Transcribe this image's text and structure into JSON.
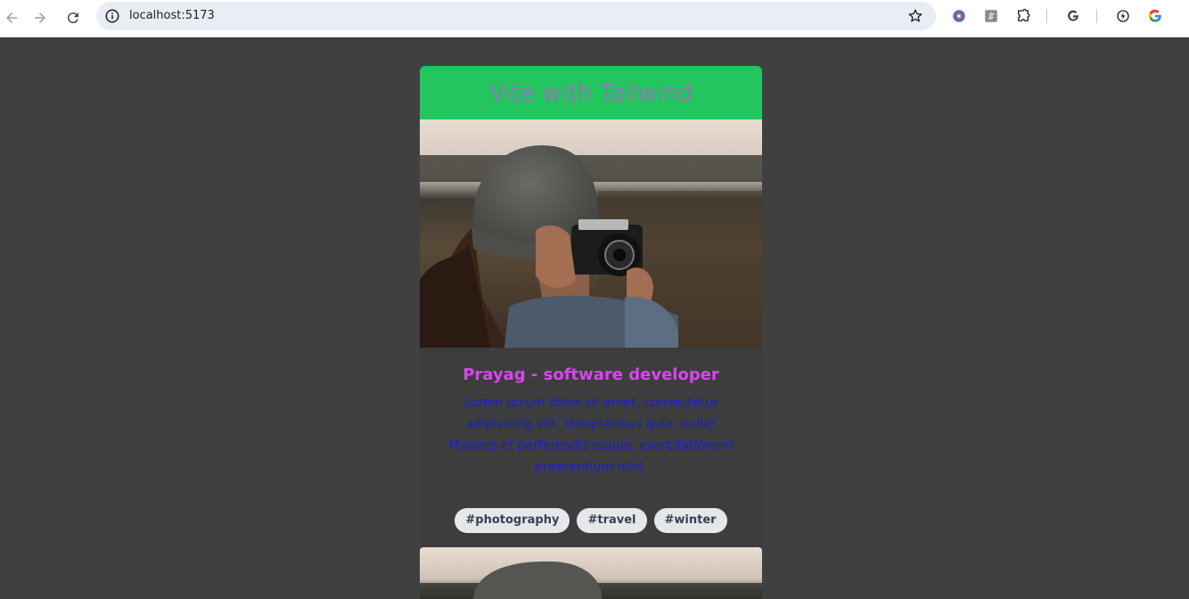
{
  "browser": {
    "url": "localhost:5173",
    "icons": [
      "back-arrow-icon",
      "forward-arrow-icon",
      "reload-icon",
      "site-info-icon",
      "bookmark-star-icon",
      "extensions-puzzle-icon",
      "google-icon"
    ]
  },
  "page": {
    "banner_title": "Vite with Tailwind",
    "card": {
      "title": "Prayag - software developer",
      "text": "Lorem ipsum dolor sit amet, consectetur adipisicing elit. Voluptatibus quia, nulla! Maiores et perferendis eaque, exercitationem praesentium nihil.",
      "tags": [
        "#photography",
        "#travel",
        "#winter"
      ]
    }
  },
  "colors": {
    "page_bg": "#404040",
    "banner_bg": "#22c55e",
    "title": "#d946ef",
    "body_text": "#1d1dd6",
    "tag_bg": "#e5e7eb"
  }
}
